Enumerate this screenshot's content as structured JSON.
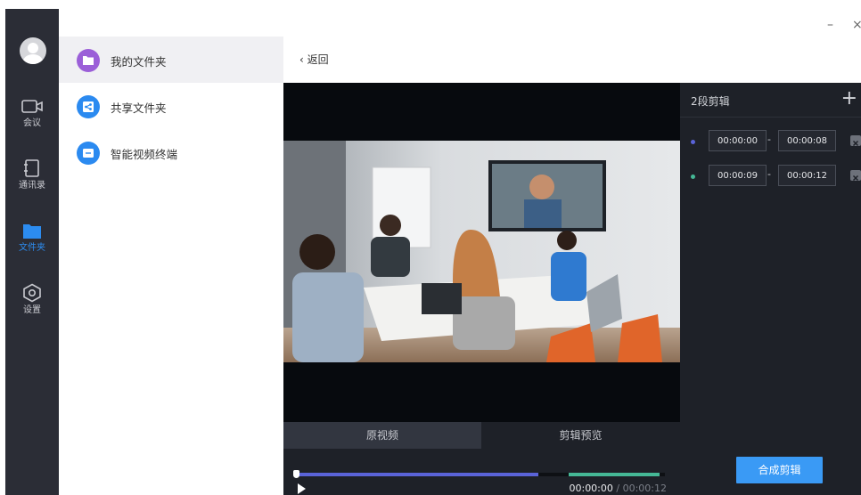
{
  "nav": {
    "items": [
      {
        "label": "会议",
        "icon": "video-camera-icon"
      },
      {
        "label": "通讯录",
        "icon": "contacts-book-icon"
      },
      {
        "label": "文件夹",
        "icon": "folder-icon",
        "active": true
      },
      {
        "label": "设置",
        "icon": "settings-hexagon-icon"
      }
    ]
  },
  "folders": {
    "items": [
      {
        "label": "我的文件夹",
        "icon": "my-folder-icon",
        "color": "#9b5fd8",
        "active": true
      },
      {
        "label": "共享文件夹",
        "icon": "share-folder-icon",
        "color": "#2b8af0"
      },
      {
        "label": "智能视频终端",
        "icon": "video-terminal-icon",
        "color": "#2b8af0"
      }
    ]
  },
  "header": {
    "back_label": "返回",
    "minimize_label": "–",
    "close_label": "×"
  },
  "player": {
    "tabs": [
      {
        "label": "原视频",
        "active": true
      },
      {
        "label": "剪辑预览"
      }
    ],
    "current_time": "00:00:00",
    "separator": " / ",
    "total_time": "00:00:12",
    "progress": 0
  },
  "clips": {
    "title": "2段剪辑",
    "add_label": "+",
    "items": [
      {
        "start": "00:00:00",
        "end": "00:00:08",
        "color": "#5a63d8"
      },
      {
        "start": "00:00:09",
        "end": "00:00:12",
        "color": "#45b896"
      }
    ],
    "dash": "-",
    "merge_label": "合成剪辑"
  },
  "colors": {
    "accent": "#2c8cf0",
    "button": "#3a9af5",
    "clip1": "#5a63d8",
    "clip2": "#45b896"
  }
}
